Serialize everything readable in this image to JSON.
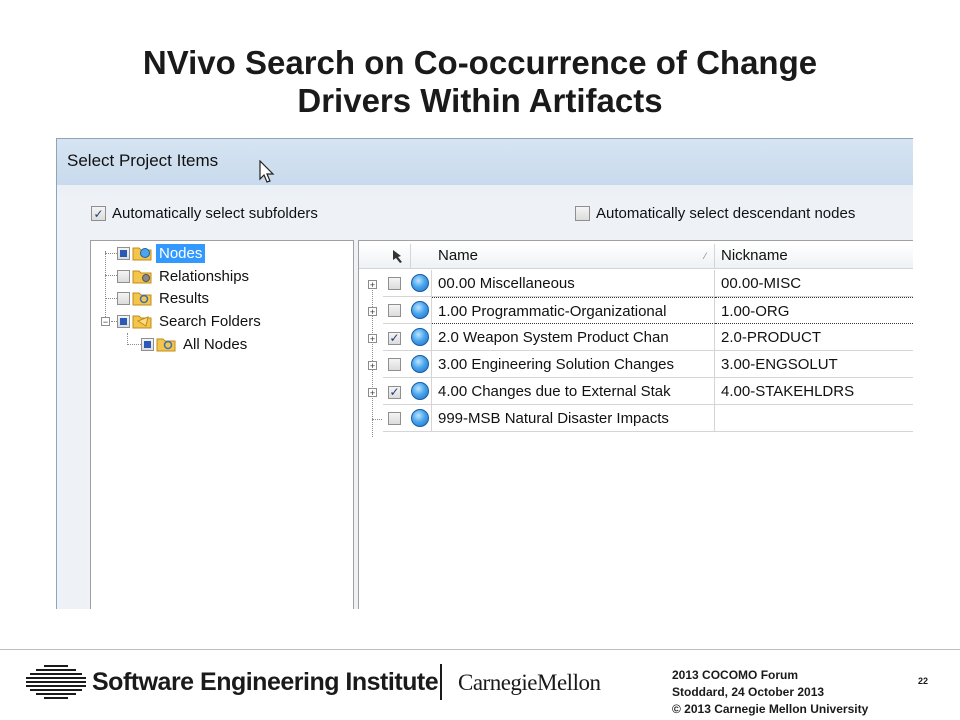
{
  "slide": {
    "title_line1": "NVivo Search on Co-occurrence of Change",
    "title_line2": "Drivers Within Artifacts"
  },
  "dialog": {
    "title": "Select Project Items",
    "auto_select_subfolders": {
      "label": "Automatically select subfolders",
      "checked": true
    },
    "auto_select_descendants": {
      "label": "Automatically select descendant nodes",
      "checked": false
    }
  },
  "tree": {
    "items": [
      {
        "label": "Nodes",
        "selected": true,
        "check": "partial",
        "icon": "nodes-folder-icon"
      },
      {
        "label": "Relationships",
        "selected": false,
        "check": "unchecked",
        "icon": "relationships-folder-icon"
      },
      {
        "label": "Results",
        "selected": false,
        "check": "unchecked",
        "icon": "results-folder-icon"
      },
      {
        "label": "Search Folders",
        "selected": false,
        "check": "partial",
        "icon": "search-folders-icon"
      },
      {
        "label": "All Nodes",
        "selected": false,
        "check": "partial",
        "icon": "all-nodes-folder-icon"
      }
    ]
  },
  "list": {
    "columns": {
      "name": "Name",
      "nickname": "Nickname"
    },
    "rows": [
      {
        "name": "00.00 Miscellaneous",
        "nickname": "00.00-MISC",
        "checked": false
      },
      {
        "name": "1.00 Programmatic-Organizational",
        "nickname": "1.00-ORG",
        "checked": false
      },
      {
        "name": "2.0  Weapon System Product Chan",
        "nickname": "2.0-PRODUCT",
        "checked": true
      },
      {
        "name": "3.00  Engineering Solution Changes",
        "nickname": "3.00-ENGSOLUT",
        "checked": false
      },
      {
        "name": "4.00  Changes due to External Stak",
        "nickname": "4.00-STAKEHLDRS",
        "checked": true
      },
      {
        "name": "999-MSB Natural Disaster Impacts",
        "nickname": "",
        "checked": false
      }
    ]
  },
  "footer": {
    "org": "Software Engineering Institute",
    "university": "CarnegieMellon",
    "forum": "2013 COCOMO Forum",
    "author_date": "Stoddard, 24 October 2013",
    "copyright": "© 2013 Carnegie Mellon University",
    "page": "22"
  },
  "colors": {
    "selection": "#3399ff",
    "node_icon": "#4aa6ec",
    "dialog_bg": "#eef2f7"
  }
}
